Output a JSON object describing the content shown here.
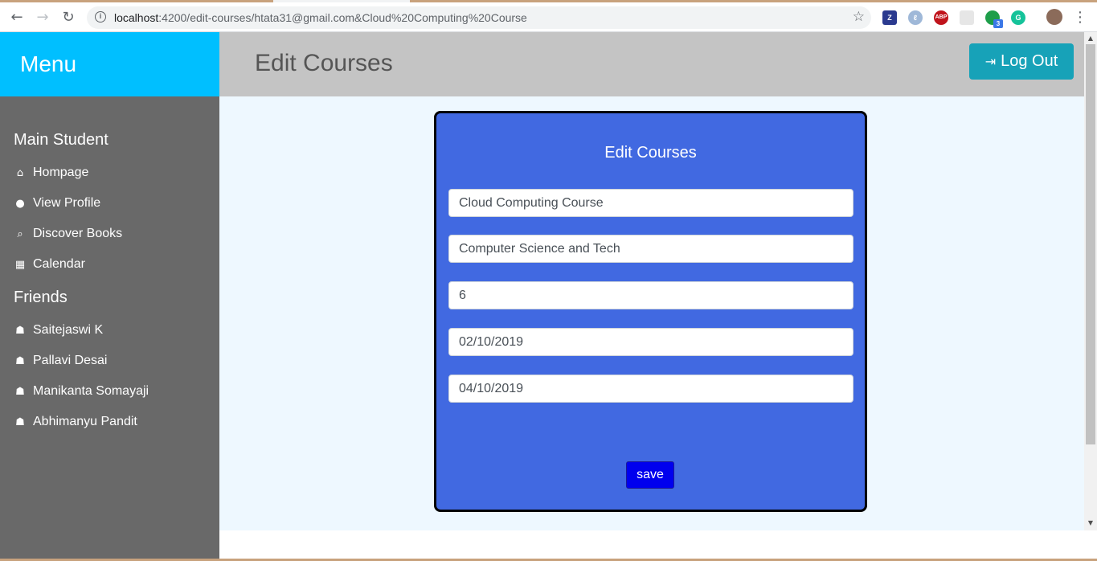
{
  "browser": {
    "url_host": "localhost",
    "url_rest": ":4200/edit-courses/htata31@gmail.com&Cloud%20Computing%20Course",
    "ext_badge": "3"
  },
  "sidebar": {
    "menu_title": "Menu",
    "section_main": "Main Student",
    "nav_items": [
      {
        "label": "Hompage",
        "icon": "home-icon"
      },
      {
        "label": "View Profile",
        "icon": "user-icon"
      },
      {
        "label": "Discover Books",
        "icon": "search-icon"
      },
      {
        "label": "Calendar",
        "icon": "calendar-icon"
      }
    ],
    "section_friends": "Friends",
    "friends": [
      {
        "label": "Saitejaswi K",
        "icon": "users-icon"
      },
      {
        "label": "Pallavi Desai",
        "icon": "users-icon"
      },
      {
        "label": "Manikanta Somayaji",
        "icon": "users-icon"
      },
      {
        "label": "Abhimanyu Pandit",
        "icon": "users-icon"
      }
    ]
  },
  "header": {
    "title": "Edit Courses",
    "logout_label": "Log Out"
  },
  "form": {
    "title": "Edit Courses",
    "course_name": "Cloud Computing Course",
    "department": "Computer Science and Tech",
    "credits": "6",
    "start_date": "02/10/2019",
    "end_date": "04/10/2019",
    "save_label": "save"
  },
  "colors": {
    "menu_header": "#00bfff",
    "sidebar": "#696969",
    "card": "#4169e1",
    "logout": "#17a2b8",
    "save_button": "#0000ee"
  }
}
